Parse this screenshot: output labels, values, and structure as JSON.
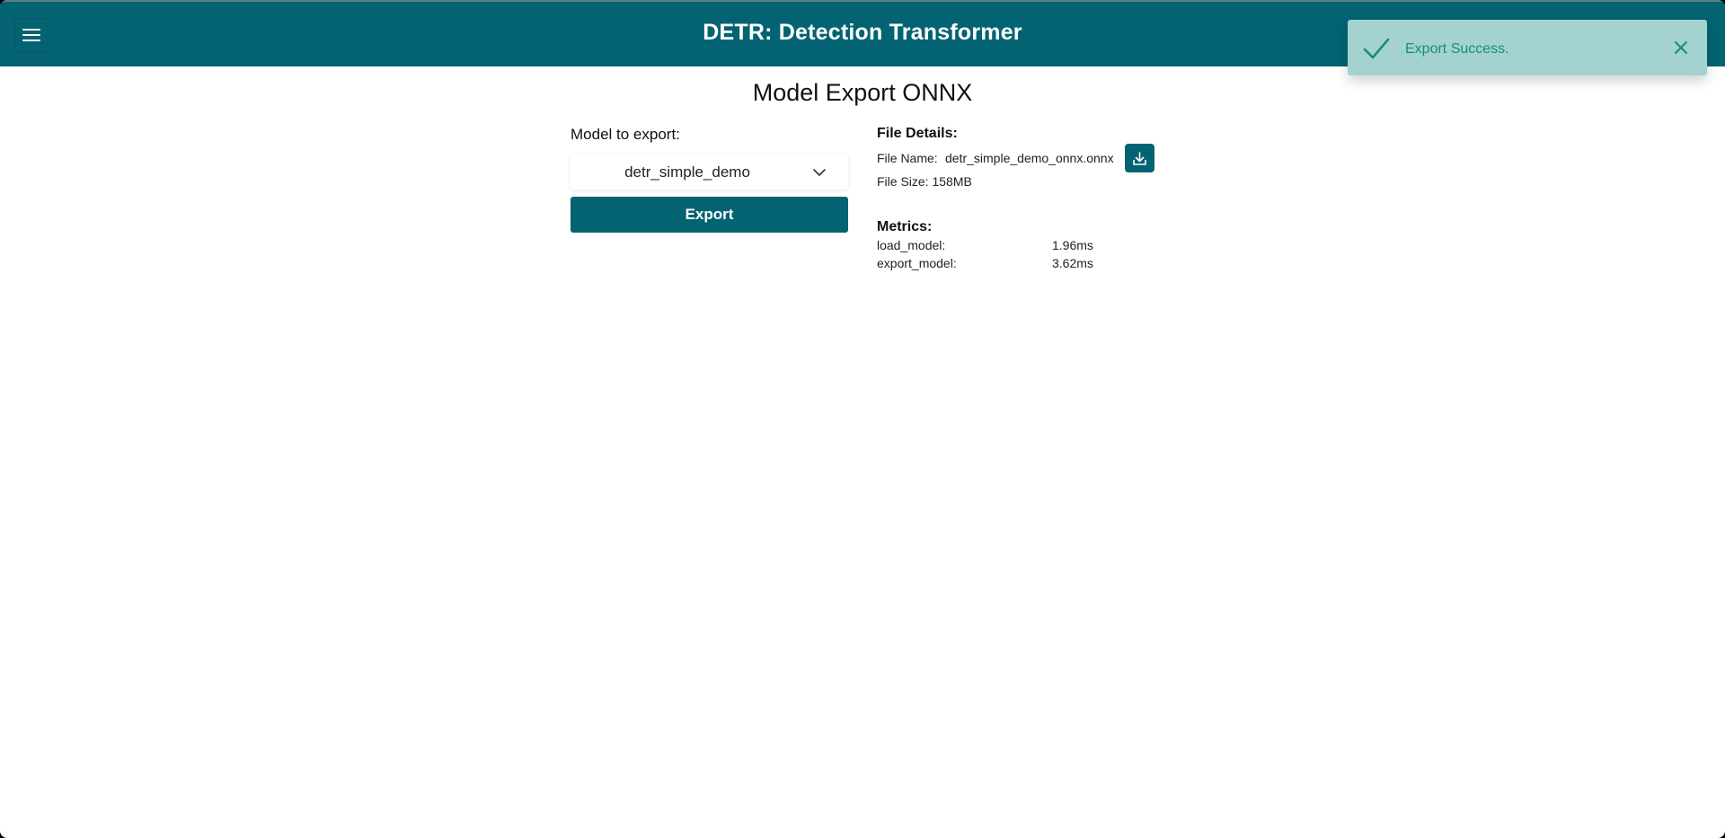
{
  "header": {
    "title": "DETR: Detection Transformer",
    "menu_icon": "hamburger-menu-icon",
    "background_color": "#036372"
  },
  "toast": {
    "message": "Export Success.",
    "status": "success",
    "icon": "check-icon",
    "close_icon": "close-icon",
    "background_color": "#a3d2cf",
    "text_color": "#168f77"
  },
  "page": {
    "heading": "Model Export ONNX"
  },
  "export_form": {
    "model_label": "Model to export:",
    "selected_model": "detr_simple_demo",
    "dropdown_icon": "chevron-down-icon",
    "export_button_label": "Export"
  },
  "file_details": {
    "title": "File Details:",
    "file_name_label": "File Name:",
    "file_name": "detr_simple_demo_onnx.onnx",
    "file_size_text": "File Size: 158MB",
    "download_icon": "download-icon"
  },
  "metrics": {
    "title": "Metrics:",
    "items": [
      {
        "name": "load_model:",
        "value": "1.96ms"
      },
      {
        "name": "export_model:",
        "value": "3.62ms"
      }
    ]
  }
}
